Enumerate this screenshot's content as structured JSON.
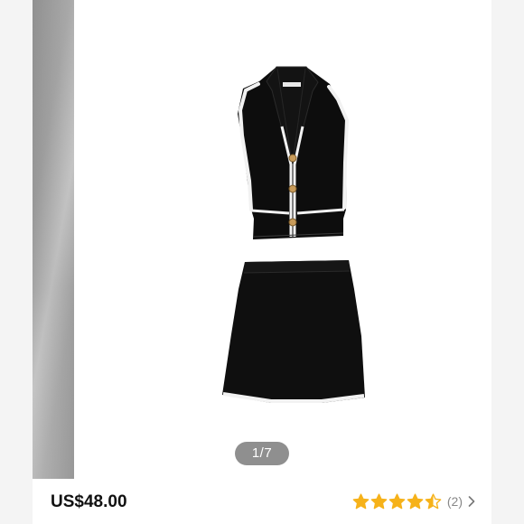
{
  "gallery": {
    "pager_current": "1",
    "pager_separator": "/",
    "pager_total": "7",
    "image_icon": "black-knit-vest-and-skirt-set"
  },
  "product": {
    "price": "US$48.00",
    "rating": 4.5,
    "rating_max": 5,
    "review_count": "(2)",
    "star_color": "#f6b21a"
  },
  "icons": {
    "chevron": "chevron-right-icon"
  }
}
